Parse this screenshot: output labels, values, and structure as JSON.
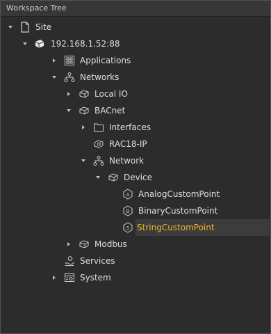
{
  "header": {
    "title": "Workspace Tree"
  },
  "tree": {
    "site": "Site",
    "ip": "192.168.1.52:88",
    "applications": "Applications",
    "networks": "Networks",
    "local_io": "Local IO",
    "bacnet": "BACnet",
    "interfaces": "Interfaces",
    "rac18": "RAC18-IP",
    "network": "Network",
    "device": "Device",
    "analog": "AnalogCustomPoint",
    "binary": "BinaryCustomPoint",
    "string": "StringCustomPoint",
    "modbus": "Modbus",
    "services": "Services",
    "system": "System"
  },
  "colors": {
    "selected_text": "#f0b429",
    "background": "#2c2c2c",
    "header": "#373737"
  }
}
